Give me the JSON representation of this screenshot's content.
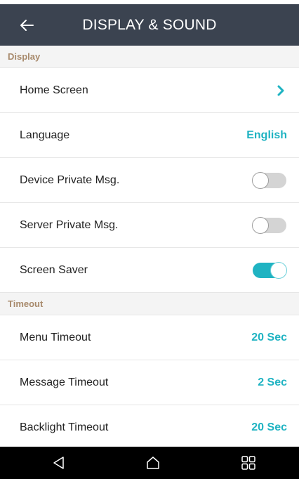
{
  "header": {
    "title": "DISPLAY & SOUND",
    "back_icon": "back-arrow-icon"
  },
  "sections": {
    "display": {
      "label": "Display",
      "rows": {
        "home_screen": {
          "label": "Home Screen",
          "icon": "chevron-right-icon"
        },
        "language": {
          "label": "Language",
          "value": "English"
        },
        "device_private_msg": {
          "label": "Device Private Msg.",
          "toggle_on": false
        },
        "server_private_msg": {
          "label": "Server Private Msg.",
          "toggle_on": false
        },
        "screen_saver": {
          "label": "Screen Saver",
          "toggle_on": true
        }
      }
    },
    "timeout": {
      "label": "Timeout",
      "rows": {
        "menu_timeout": {
          "label": "Menu Timeout",
          "value": "20 Sec"
        },
        "message_timeout": {
          "label": "Message Timeout",
          "value": "2 Sec"
        },
        "backlight_timeout": {
          "label": "Backlight Timeout",
          "value": "20 Sec"
        }
      }
    }
  },
  "nav": {
    "back_icon": "nav-back-triangle-icon",
    "home_icon": "nav-home-icon",
    "apps_icon": "nav-apps-grid-icon"
  },
  "colors": {
    "header_bg": "#3b4350",
    "accent": "#1fb3c2",
    "section_label": "#a88a6c",
    "section_bg": "#f4f4f4",
    "nav_bg": "#000000"
  }
}
